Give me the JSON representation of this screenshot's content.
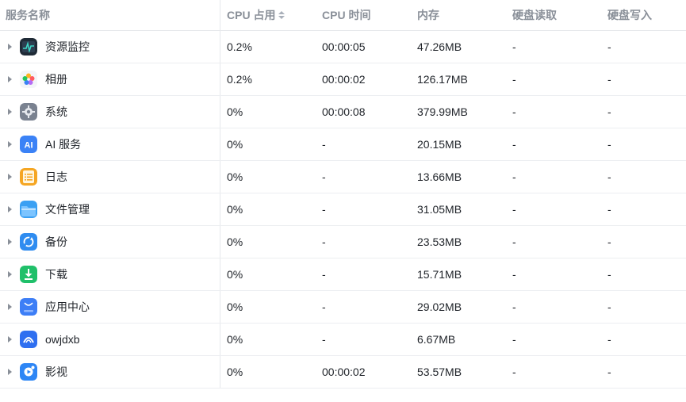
{
  "headers": {
    "name": "服务名称",
    "cpu": "CPU 占用",
    "cpu_time": "CPU 时间",
    "memory": "内存",
    "disk_read": "硬盘读取",
    "disk_write": "硬盘写入"
  },
  "rows": [
    {
      "name": "资源监控",
      "icon": "resource-monitor-icon",
      "cpu": "0.2%",
      "cpu_time": "00:00:05",
      "memory": "47.26MB",
      "disk_read": "-",
      "disk_write": "-"
    },
    {
      "name": "相册",
      "icon": "photos-icon",
      "cpu": "0.2%",
      "cpu_time": "00:00:02",
      "memory": "126.17MB",
      "disk_read": "-",
      "disk_write": "-"
    },
    {
      "name": "系统",
      "icon": "system-gear-icon",
      "cpu": "0%",
      "cpu_time": "00:00:08",
      "memory": "379.99MB",
      "disk_read": "-",
      "disk_write": "-"
    },
    {
      "name": "AI 服务",
      "icon": "ai-service-icon",
      "cpu": "0%",
      "cpu_time": "-",
      "memory": "20.15MB",
      "disk_read": "-",
      "disk_write": "-"
    },
    {
      "name": "日志",
      "icon": "log-icon",
      "cpu": "0%",
      "cpu_time": "-",
      "memory": "13.66MB",
      "disk_read": "-",
      "disk_write": "-"
    },
    {
      "name": "文件管理",
      "icon": "file-manager-icon",
      "cpu": "0%",
      "cpu_time": "-",
      "memory": "31.05MB",
      "disk_read": "-",
      "disk_write": "-"
    },
    {
      "name": "备份",
      "icon": "backup-icon",
      "cpu": "0%",
      "cpu_time": "-",
      "memory": "23.53MB",
      "disk_read": "-",
      "disk_write": "-"
    },
    {
      "name": "下载",
      "icon": "download-icon",
      "cpu": "0%",
      "cpu_time": "-",
      "memory": "15.71MB",
      "disk_read": "-",
      "disk_write": "-"
    },
    {
      "name": "应用中心",
      "icon": "app-store-icon",
      "cpu": "0%",
      "cpu_time": "-",
      "memory": "29.02MB",
      "disk_read": "-",
      "disk_write": "-"
    },
    {
      "name": "owjdxb",
      "icon": "owjdxb-icon",
      "cpu": "0%",
      "cpu_time": "-",
      "memory": "6.67MB",
      "disk_read": "-",
      "disk_write": "-"
    },
    {
      "name": "影视",
      "icon": "video-icon",
      "cpu": "0%",
      "cpu_time": "00:00:02",
      "memory": "53.57MB",
      "disk_read": "-",
      "disk_write": "-"
    }
  ]
}
